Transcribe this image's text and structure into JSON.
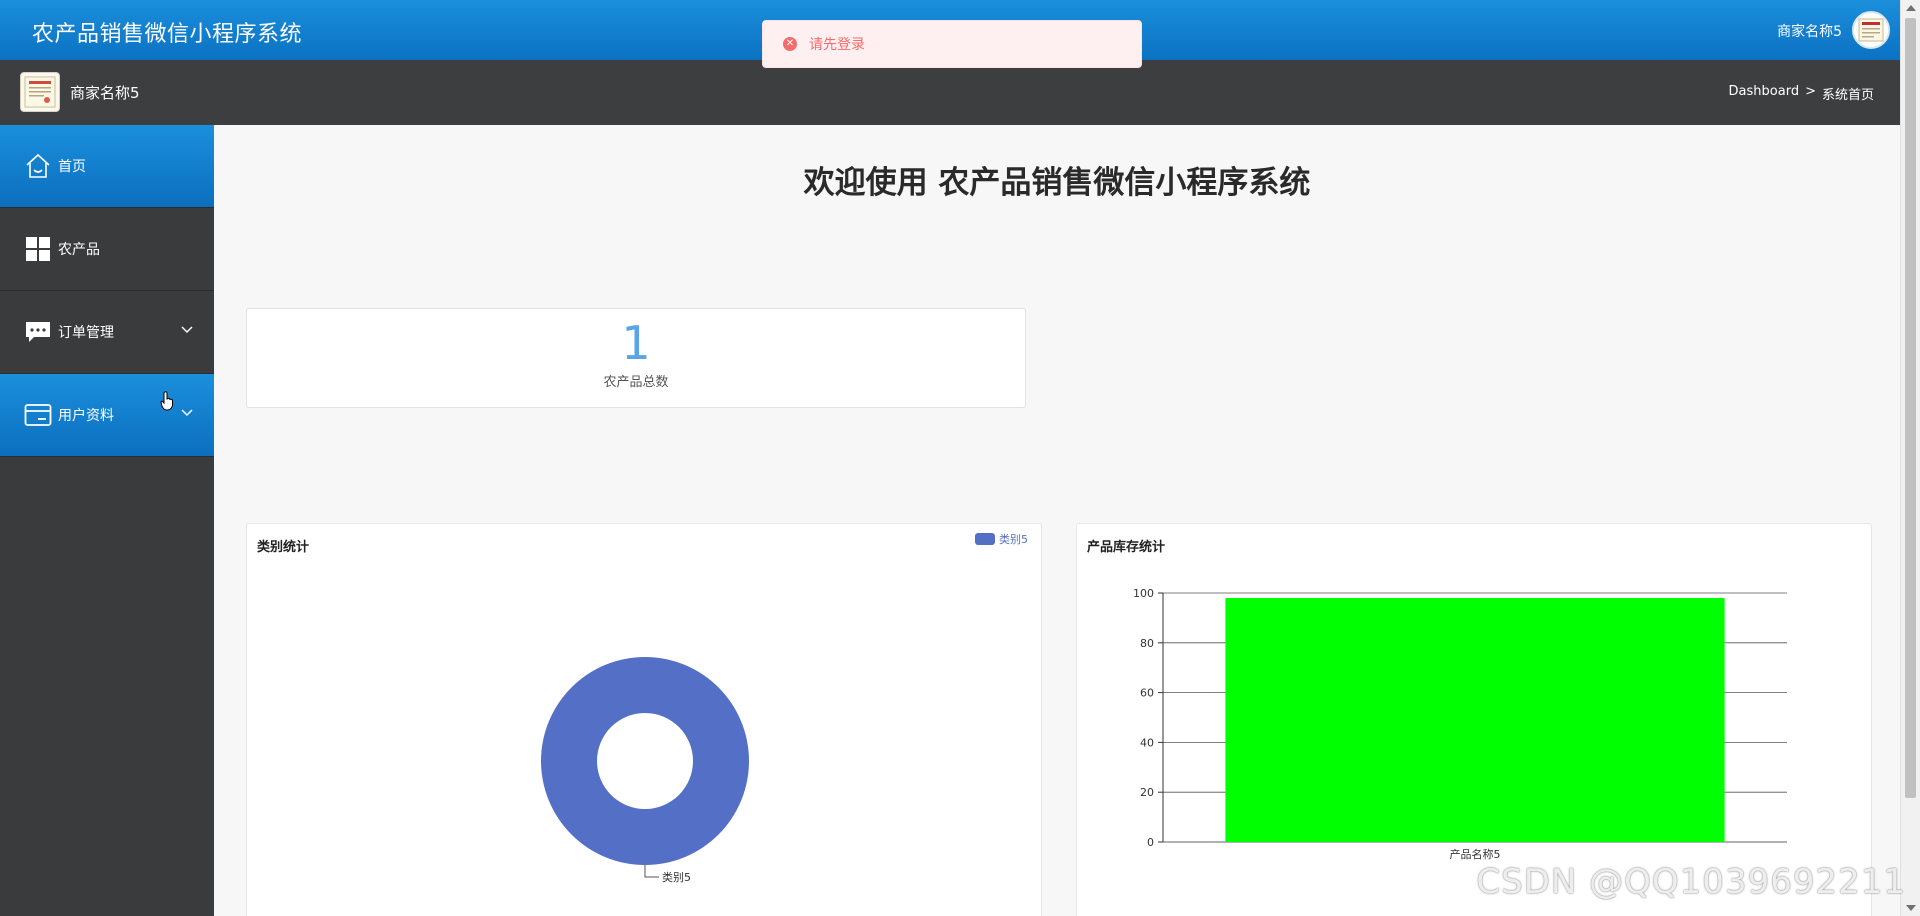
{
  "header": {
    "app_title": "农产品销售微信小程序系统",
    "user_name": "商家名称5"
  },
  "subbar": {
    "store_name": "商家名称5",
    "breadcrumb": [
      "Dashboard",
      ">",
      "系统首页"
    ]
  },
  "sidebar": {
    "items": [
      {
        "label": "首页",
        "icon": "home-icon",
        "active": true
      },
      {
        "label": "农产品",
        "icon": "grid-icon",
        "active": false
      },
      {
        "label": "订单管理",
        "icon": "chat-icon",
        "active": false,
        "expandable": true
      },
      {
        "label": "用户资料",
        "icon": "card-icon",
        "active": true,
        "expandable": true
      }
    ]
  },
  "main": {
    "welcome": "欢迎使用 农产品销售微信小程序系统",
    "stat": {
      "value": "1",
      "label": "农产品总数"
    }
  },
  "toast": {
    "text": "请先登录",
    "icon": "error-circle-icon",
    "color": "#f56c6c"
  },
  "watermark": "CSDN @QQ1039692211",
  "colors": {
    "brand_blue": "#0b72c2",
    "sidebar_dark": "#3a3b3d",
    "donut": "#5470c6",
    "bar": "#00ff00"
  },
  "chart_data": [
    {
      "type": "pie",
      "title": "类别统计",
      "categories": [
        "类别5"
      ],
      "values": [
        1
      ],
      "legend": [
        "类别5"
      ],
      "legend_position": "top-right",
      "donut": true
    },
    {
      "type": "bar",
      "title": "产品库存统计",
      "categories": [
        "产品名称5"
      ],
      "values": [
        98
      ],
      "ylim": [
        0,
        100
      ],
      "yticks": [
        0,
        20,
        40,
        60,
        80,
        100
      ],
      "grid": true
    }
  ]
}
